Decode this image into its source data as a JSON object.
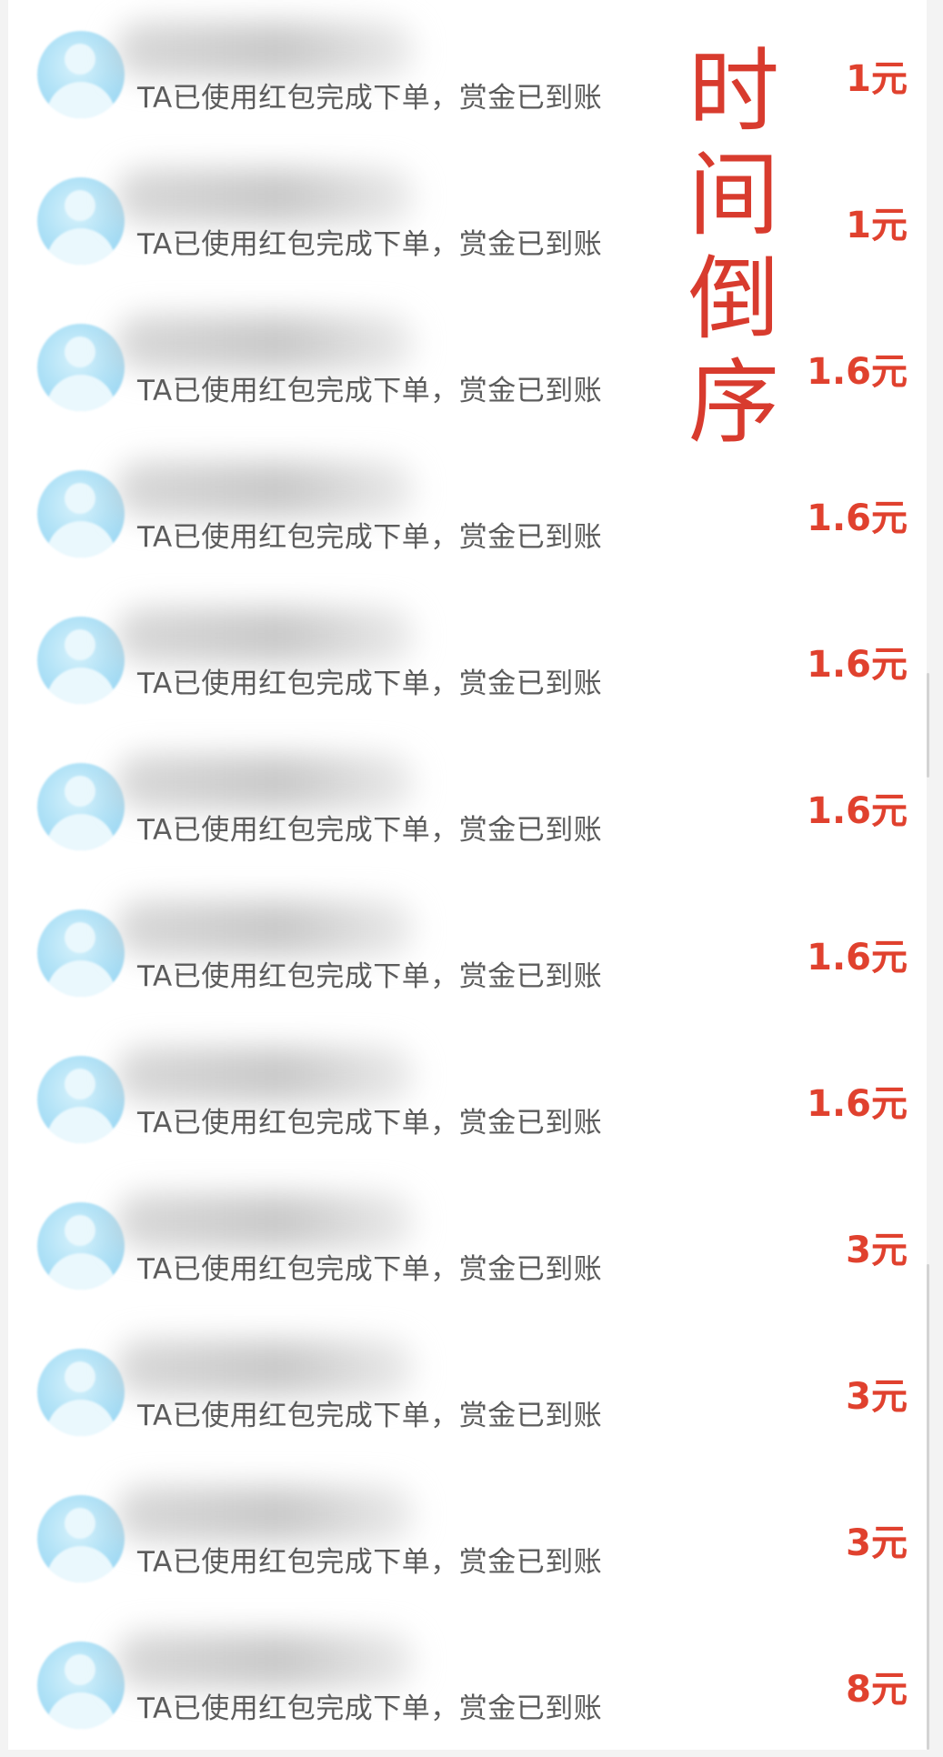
{
  "rows": [
    {
      "desc": "TA已使用红包完成下单，赏金已到账",
      "amount": "1元"
    },
    {
      "desc": "TA已使用红包完成下单，赏金已到账",
      "amount": "1元"
    },
    {
      "desc": "TA已使用红包完成下单，赏金已到账",
      "amount": "1.6元"
    },
    {
      "desc": "TA已使用红包完成下单，赏金已到账",
      "amount": "1.6元"
    },
    {
      "desc": "TA已使用红包完成下单，赏金已到账",
      "amount": "1.6元"
    },
    {
      "desc": "TA已使用红包完成下单，赏金已到账",
      "amount": "1.6元"
    },
    {
      "desc": "TA已使用红包完成下单，赏金已到账",
      "amount": "1.6元"
    },
    {
      "desc": "TA已使用红包完成下单，赏金已到账",
      "amount": "1.6元"
    },
    {
      "desc": "TA已使用红包完成下单，赏金已到账",
      "amount": "3元"
    },
    {
      "desc": "TA已使用红包完成下单，赏金已到账",
      "amount": "3元"
    },
    {
      "desc": "TA已使用红包完成下单，赏金已到账",
      "amount": "3元"
    },
    {
      "desc": "TA已使用红包完成下单，赏金已到账",
      "amount": "8元"
    }
  ],
  "overlay": {
    "chars": [
      "时",
      "间",
      "倒",
      "序"
    ]
  },
  "colors": {
    "amount": "#e0412e",
    "overlay_text": "#d83b2e",
    "description": "#5c5c5c",
    "background": "#ffffff"
  },
  "icons": {
    "avatar": "user-avatar-icon"
  }
}
